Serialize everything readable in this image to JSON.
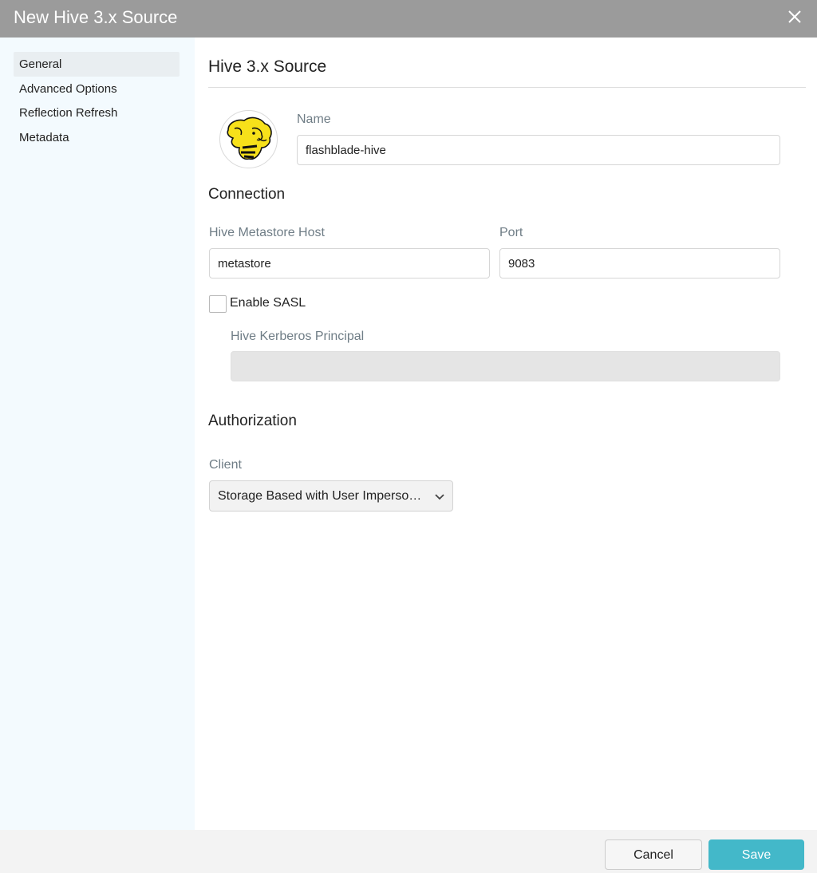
{
  "window": {
    "title": "New Hive 3.x Source"
  },
  "sidebar": {
    "items": [
      {
        "label": "General",
        "active": true
      },
      {
        "label": "Advanced Options",
        "active": false
      },
      {
        "label": "Reflection Refresh",
        "active": false
      },
      {
        "label": "Metadata",
        "active": false
      }
    ]
  },
  "main": {
    "heading": "Hive 3.x Source",
    "name": {
      "label": "Name",
      "value": "flashblade-hive"
    },
    "connection": {
      "title": "Connection",
      "host": {
        "label": "Hive Metastore Host",
        "value": "metastore"
      },
      "port": {
        "label": "Port",
        "value": "9083"
      },
      "sasl": {
        "label": "Enable SASL",
        "checked": false
      },
      "kerberos": {
        "label": "Hive Kerberos Principal",
        "value": ""
      }
    },
    "authorization": {
      "title": "Authorization",
      "client": {
        "label": "Client",
        "value": "Storage Based with User Impersonation"
      }
    }
  },
  "footer": {
    "cancel_label": "Cancel",
    "save_label": "Save"
  },
  "icons": {
    "close": "close-icon",
    "logo": "hive-logo-icon",
    "dropdown": "chevron-down-icon"
  },
  "colors": {
    "titlebar": "#9b9b9b",
    "sidebar": "#f3fafe",
    "save": "#43b8c9",
    "label": "#6f7d86"
  }
}
